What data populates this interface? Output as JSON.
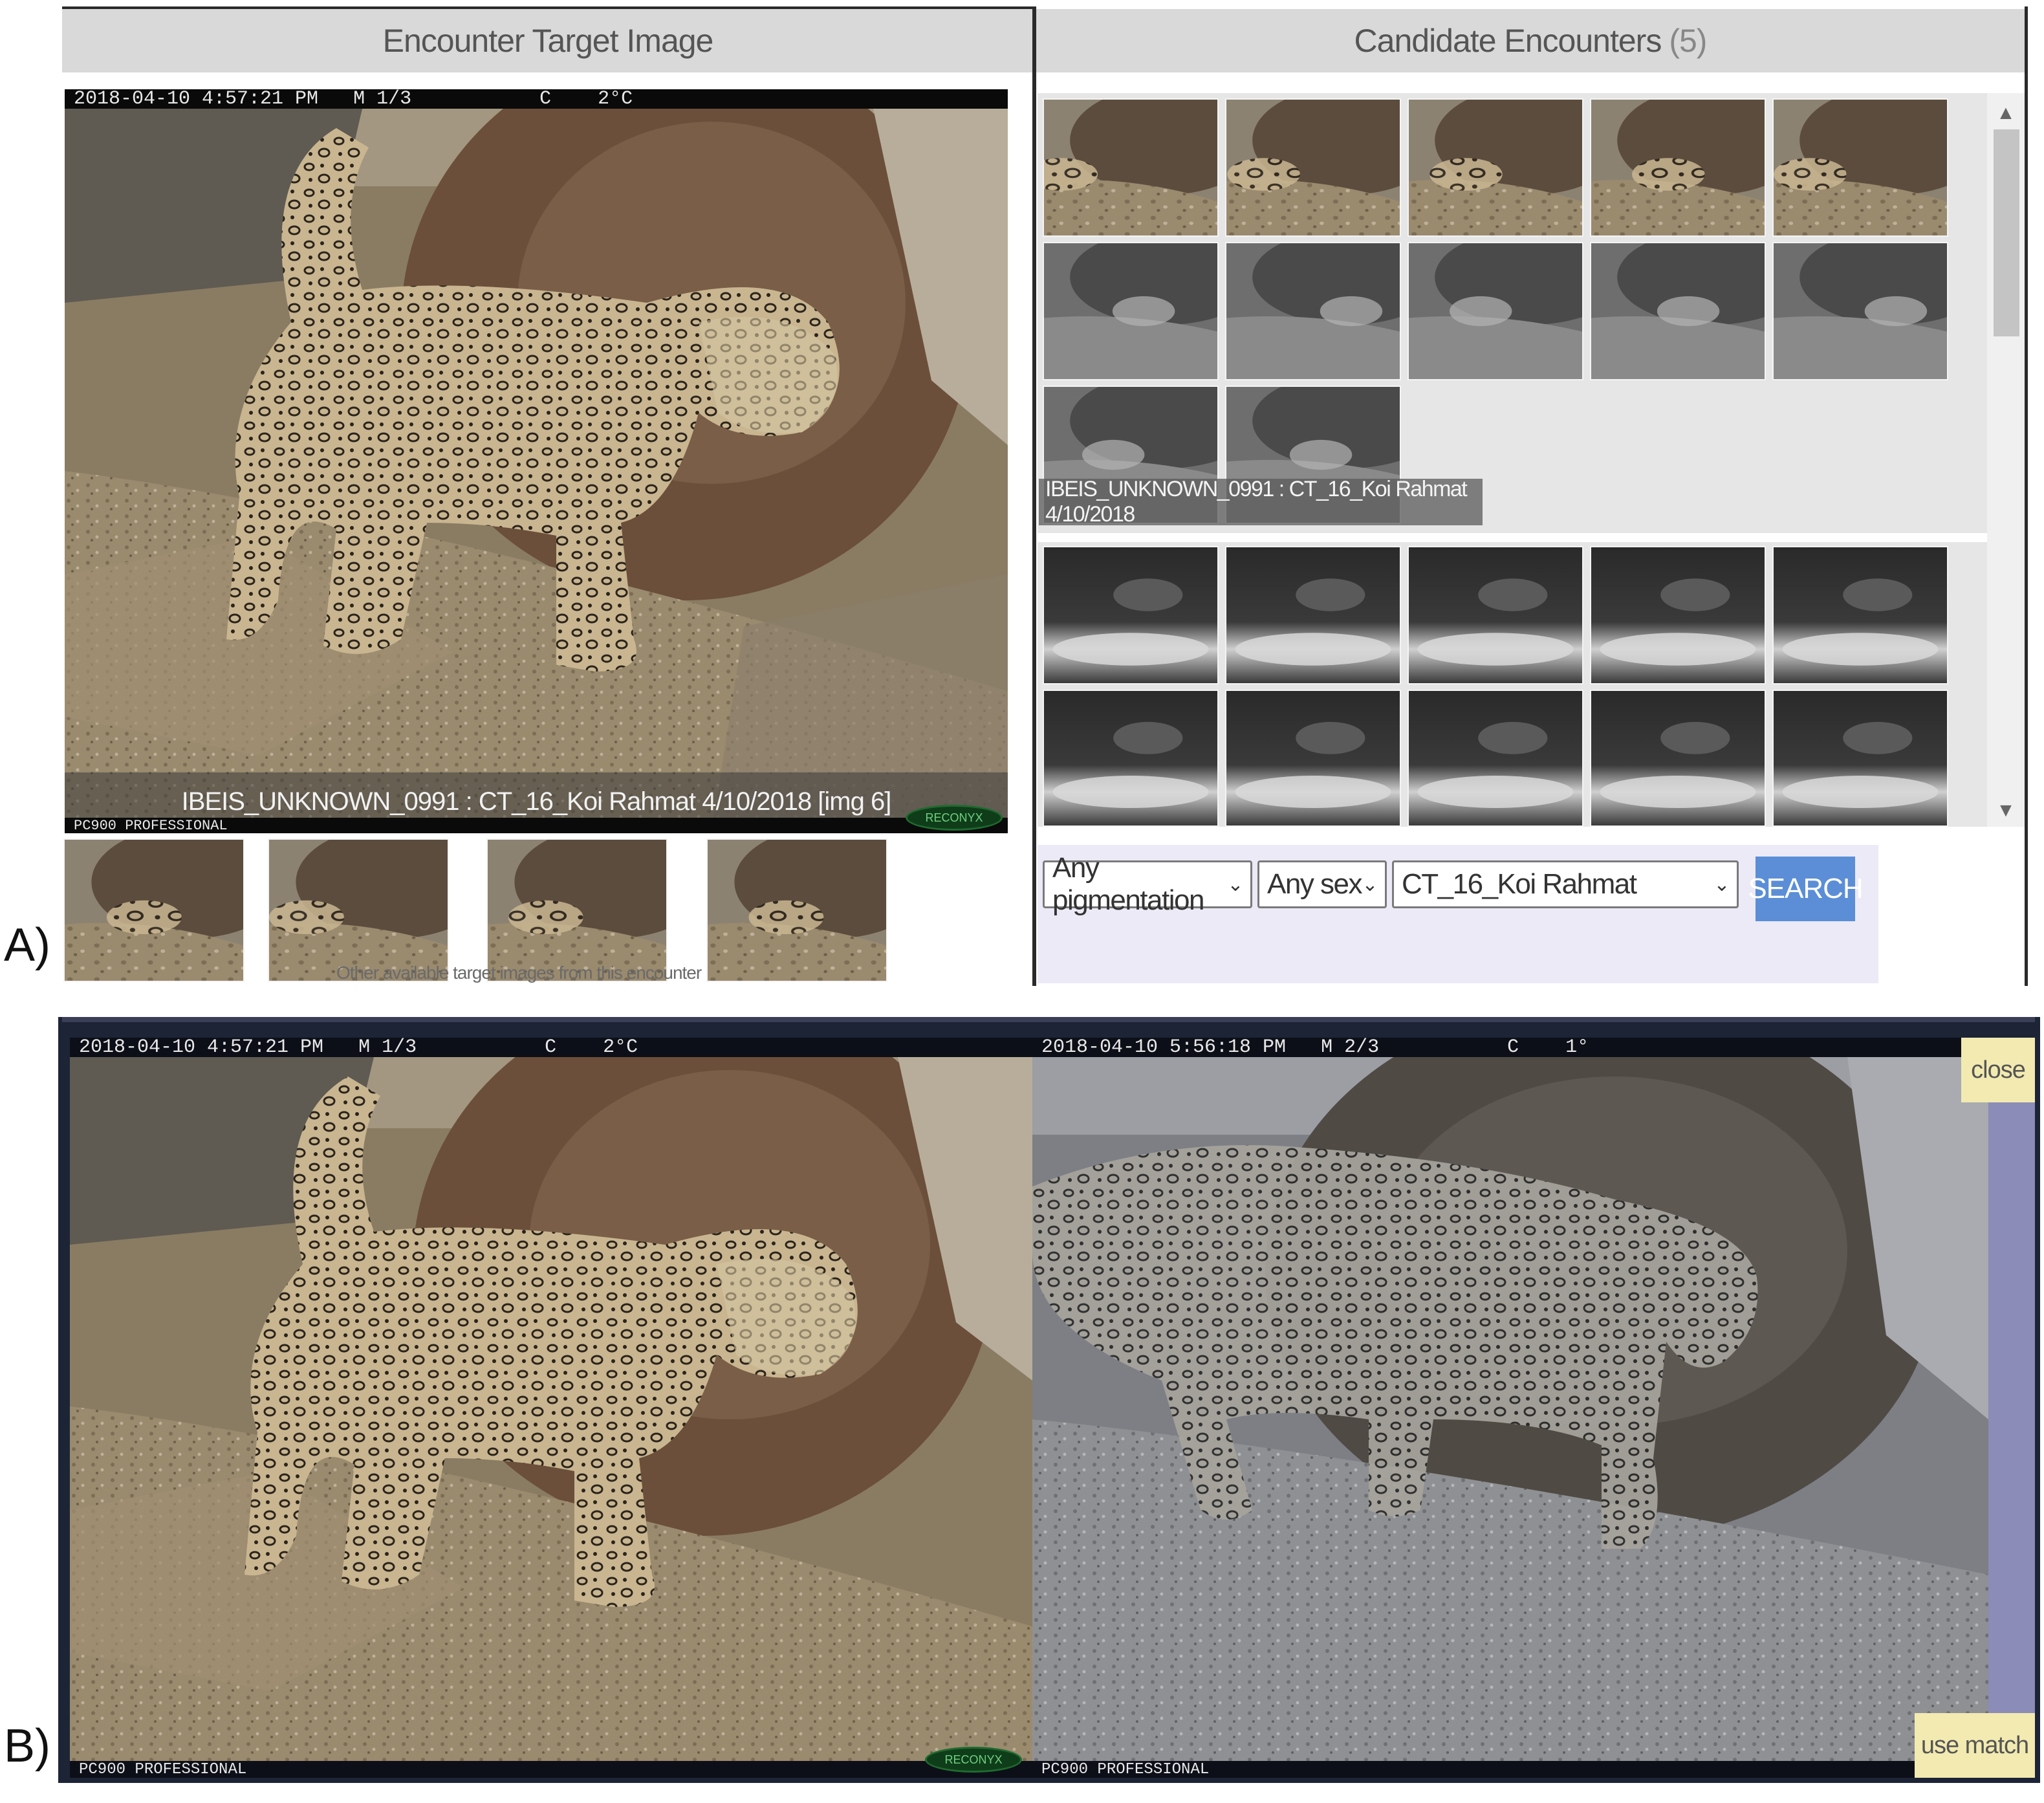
{
  "panel_a": {
    "label": "A)",
    "target": {
      "header": "Encounter Target Image",
      "camera_stamp": "2018-04-10 4:57:21 PM   M 1/3           C    2°C",
      "footer_stamp": "PC900 PROFESSIONAL",
      "logo_text": "RECONYX",
      "caption": "IBEIS_UNKNOWN_0991 : CT_16_Koi Rahmat 4/10/2018 [img 6]",
      "other_images_caption": "Other available target images from this encounter"
    },
    "candidates": {
      "header": "Candidate Encounters",
      "count": "(5)",
      "encounter_1_tag": "IBEIS_UNKNOWN_0991 : CT_16_Koi Rahmat 4/10/2018",
      "encounter_1_thumbs": 12,
      "encounter_2_thumbs": 15,
      "scroll_up_icon": "▲",
      "scroll_down_icon": "▼"
    },
    "filters": {
      "pigmentation": "Any pigmentation",
      "sex": "Any sex",
      "location": "CT_16_Koi Rahmat",
      "search_label": "SEARCH",
      "chevron": "⌄"
    }
  },
  "panel_b": {
    "label": "B)",
    "left_stamp": "2018-04-10 4:57:21 PM   M 1/3           C    2°C",
    "right_stamp": "2018-04-10 5:56:18 PM   M 2/3           C    1°",
    "left_footer": "PC900 PROFESSIONAL",
    "right_footer": "PC900 PROFESSIONAL",
    "logo_text": "RECONYX",
    "close_label": "close",
    "use_match_label": "use match"
  },
  "colors": {
    "header_bg": "#d9d9d9",
    "search_button": "#5b8ed6",
    "filter_bg": "#eceaf6",
    "frame_dark": "#1d2436",
    "sidebar": "#8c8cb8",
    "yellow_button": "#f2eab0"
  }
}
